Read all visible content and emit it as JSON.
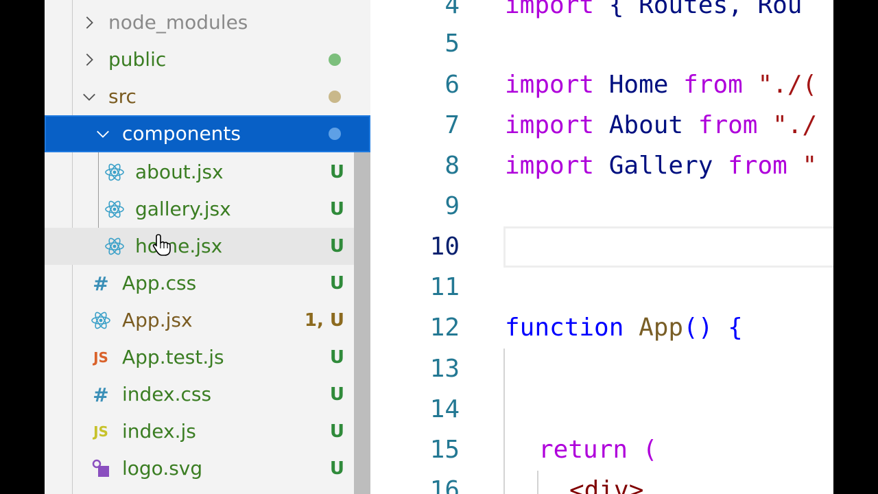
{
  "explorer": {
    "items": [
      {
        "label": "node_modules",
        "status": "",
        "icon": "chevron-right-icon"
      },
      {
        "label": "public",
        "status": "",
        "icon": "chevron-right-icon"
      },
      {
        "label": "src",
        "status": "",
        "icon": "chevron-down-icon"
      },
      {
        "label": "components",
        "status": "",
        "icon": "chevron-down-icon"
      },
      {
        "label": "about.jsx",
        "status": "U",
        "icon": "react-icon"
      },
      {
        "label": "gallery.jsx",
        "status": "U",
        "icon": "react-icon"
      },
      {
        "label": "home.jsx",
        "status": "U",
        "icon": "react-icon"
      },
      {
        "label": "App.css",
        "status": "U",
        "icon": "css-hash-icon"
      },
      {
        "label": "App.jsx",
        "status": "1, U",
        "icon": "react-icon"
      },
      {
        "label": "App.test.js",
        "status": "U",
        "icon": "js-icon"
      },
      {
        "label": "index.css",
        "status": "U",
        "icon": "css-hash-icon"
      },
      {
        "label": "index.js",
        "status": "U",
        "icon": "js-icon"
      },
      {
        "label": "logo.svg",
        "status": "U",
        "icon": "svg-shapes-icon"
      }
    ],
    "icon_glyphs": {
      "css": "#",
      "js": "JS"
    }
  },
  "editor": {
    "line_numbers": [
      "4",
      "5",
      "6",
      "7",
      "8",
      "9",
      "10",
      "11",
      "12",
      "13",
      "14",
      "15",
      "16"
    ],
    "active_line": "10",
    "lines": {
      "l4": {
        "kw": "import",
        "rest": " { Routes, Rou"
      },
      "l6": {
        "kw": "import",
        "name": " Home ",
        "from": "from",
        "str": " \"./("
      },
      "l7": {
        "kw": "import",
        "name": " About ",
        "from": "from",
        "str": " \"./"
      },
      "l8": {
        "kw": "import",
        "name": " Gallery ",
        "from": "from",
        "str": " \""
      },
      "l12": {
        "kw": "function",
        "name": " App",
        "paren": "()",
        "brace": " {"
      },
      "l15": {
        "kw": "return",
        "paren": " ("
      },
      "l16": {
        "tag": "<div>"
      }
    }
  },
  "colors": {
    "selection": "#0860c6",
    "keyword": "#af00db",
    "line_number": "#237893",
    "git_untracked": "#3a7d22"
  }
}
